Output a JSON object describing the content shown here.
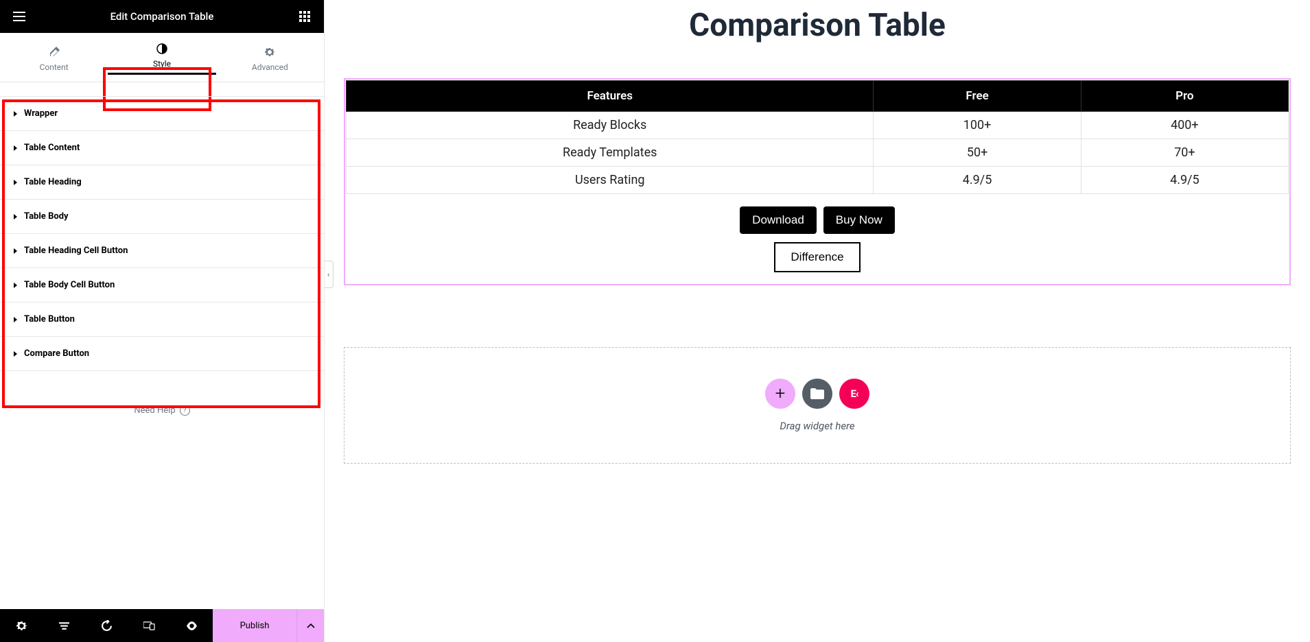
{
  "sidebar": {
    "title": "Edit Comparison Table",
    "tabs": {
      "content": "Content",
      "style": "Style",
      "advanced": "Advanced"
    },
    "accordion": [
      "Wrapper",
      "Table Content",
      "Table Heading",
      "Table Body",
      "Table Heading Cell Button",
      "Table Body Cell Button",
      "Table Button",
      "Compare Button"
    ],
    "help": "Need Help",
    "footer": {
      "publish": "Publish"
    }
  },
  "preview": {
    "heading": "Comparison Table",
    "table": {
      "headers": [
        "Features",
        "Free",
        "Pro"
      ],
      "rows": [
        [
          "Ready Blocks",
          "100+",
          "400+"
        ],
        [
          "Ready Templates",
          "50+",
          "70+"
        ],
        [
          "Users Rating",
          "4.9/5",
          "4.9/5"
        ]
      ]
    },
    "buttons": {
      "download": "Download",
      "buy": "Buy Now",
      "difference": "Difference"
    },
    "dropzone": "Drag widget here"
  }
}
